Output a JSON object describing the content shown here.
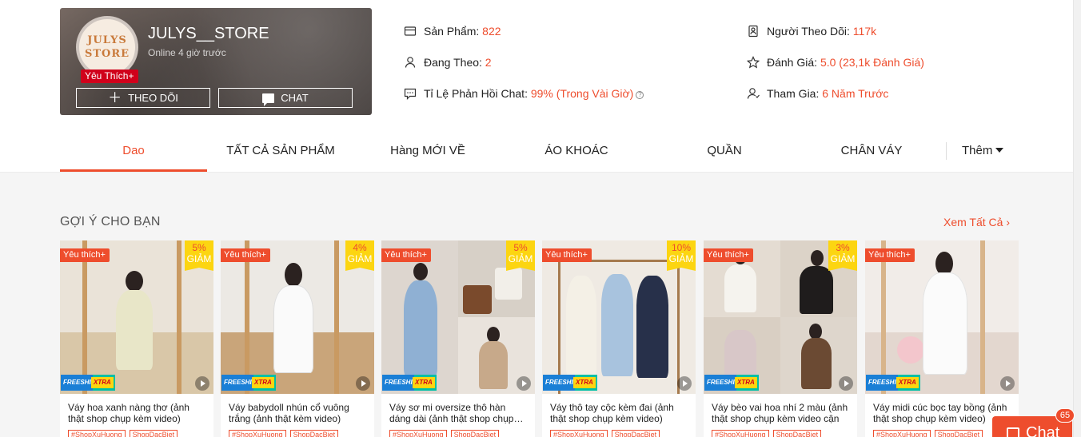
{
  "shop": {
    "avatar_text_line1": "JULYS",
    "avatar_text_line2": "STORE",
    "badge": "Yêu Thích+",
    "name": "JULYS__STORE",
    "status": "Online 4 giờ trước",
    "follow_label": "THEO DÕI",
    "chat_label": "CHAT"
  },
  "stats": {
    "products_label": "Sản Phẩm:",
    "products_value": "822",
    "following_label": "Đang Theo:",
    "following_value": "2",
    "response_label": "Tỉ Lệ Phản Hồi Chat:",
    "response_value": "99% (Trong Vài Giờ)",
    "followers_label": "Người Theo Dõi:",
    "followers_value": "117k",
    "rating_label": "Đánh Giá:",
    "rating_value": "5.0 (23,1k Đánh Giá)",
    "joined_label": "Tham Gia:",
    "joined_value": "6 Năm Trước"
  },
  "tabs": [
    "Dao",
    "TẤT CẢ SẢN PHẨM",
    "Hàng MỚI VỀ",
    "ÁO KHOÁC",
    "QUẦN",
    "CHÂN VÁY"
  ],
  "more_label": "Thêm",
  "section": {
    "title": "GỢI Ý CHO BẠN",
    "see_all": "Xem Tất Cả"
  },
  "colors": {
    "accent": "#ee4d2d",
    "badge_yellow": "#fcd511",
    "freeship_blue": "#1a7fd6"
  },
  "products": [
    {
      "badge": "Yêu thích+",
      "discount": "5%",
      "discount_label": "GIẢM",
      "freeship_a": "FREESHIP",
      "freeship_b": "XTRA",
      "name": "Váy hoa xanh nàng thơ (ảnh thật shop chụp kèm video)",
      "tag1": "#ShopXuHuong",
      "tag2": "ShopDacBiet"
    },
    {
      "badge": "Yêu thích+",
      "discount": "4%",
      "discount_label": "GIẢM",
      "freeship_a": "FREESHIP",
      "freeship_b": "XTRA",
      "name": "Váy babydoll nhún cổ vuông trắng (ảnh thật kèm video)",
      "tag1": "#ShopXuHuong",
      "tag2": "ShopDacBiet"
    },
    {
      "badge": "Yêu thích+",
      "discount": "5%",
      "discount_label": "GIẢM",
      "freeship_a": "FREESHIP",
      "freeship_b": "XTRA",
      "name": "Váy sơ mi oversize thô hàn dáng dài (ảnh thật shop chụp…",
      "tag1": "#ShopXuHuong",
      "tag2": "ShopDacBiet"
    },
    {
      "badge": "Yêu thích+",
      "discount": "10%",
      "discount_label": "GIẢM",
      "freeship_a": "FREESHIP",
      "freeship_b": "XTRA",
      "name": "Váy thô tay cộc kèm đai (ảnh thật shop chụp kèm video)",
      "tag1": "#ShopXuHuong",
      "tag2": "ShopDacBiet"
    },
    {
      "badge": "Yêu thích+",
      "discount": "3%",
      "discount_label": "GIẢM",
      "freeship_a": "FREESHIP",
      "freeship_b": "XTRA",
      "name": "Váy bèo vai hoa nhí 2 màu (ảnh thật shop chụp kèm video cận",
      "tag1": "#ShopXuHuong",
      "tag2": "ShopDacBiet"
    },
    {
      "badge": "Yêu thích+",
      "discount": "",
      "discount_label": "",
      "freeship_a": "FREESHIP",
      "freeship_b": "XTRA",
      "name": "Váy midi cúc bọc tay bồng (ảnh thật shop chụp kèm video)",
      "tag1": "#ShopXuHuong",
      "tag2": "ShopDacBiet"
    }
  ],
  "chat_widget": {
    "label": "Chat",
    "count": "65"
  }
}
